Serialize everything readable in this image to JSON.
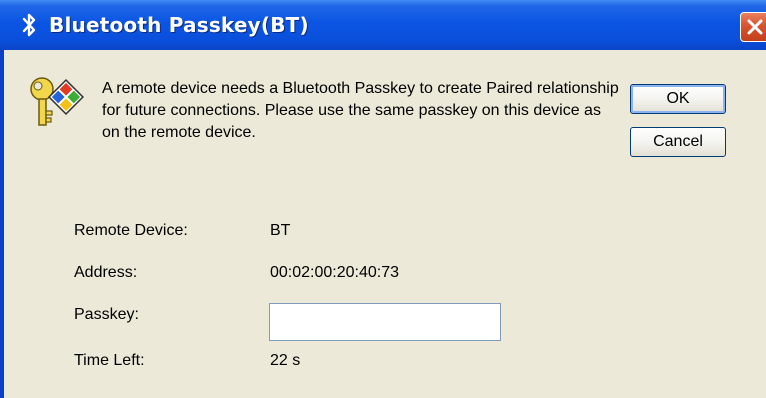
{
  "window": {
    "title": "Bluetooth Passkey(BT)",
    "title_icon": "bluetooth-icon",
    "close_icon": "close-icon"
  },
  "dialog": {
    "icon": "key-icon",
    "message": "A remote device needs a Bluetooth Passkey to create Paired relationship for future connections. Please use the same passkey on this device as on the remote device."
  },
  "buttons": {
    "ok_label": "OK",
    "cancel_label": "Cancel"
  },
  "fields": {
    "remote_device": {
      "label": "Remote Device:",
      "value": "BT"
    },
    "address": {
      "label": "Address:",
      "value": "00:02:00:20:40:73"
    },
    "passkey": {
      "label": "Passkey:",
      "value": "",
      "placeholder": ""
    },
    "time_left": {
      "label": "Time Left:",
      "value": "22 s"
    }
  },
  "colors": {
    "titlebar": "#0a4fdb",
    "client_bg": "#ece9d8",
    "close_button": "#d8542e"
  }
}
